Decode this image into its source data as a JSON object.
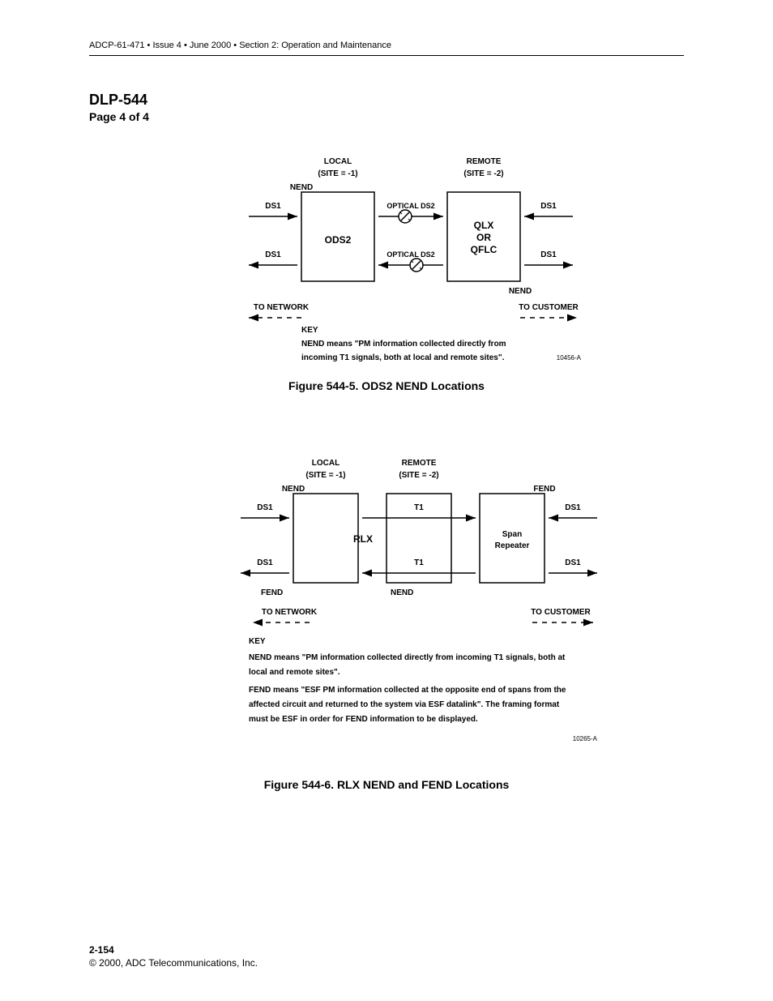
{
  "header": "ADCP-61-471 • Issue 4 • June 2000 • Section 2: Operation and Maintenance",
  "dlp": {
    "title": "DLP-544",
    "page": "Page 4 of 4"
  },
  "fig1": {
    "caption": "Figure 544-5. ODS2 NEND Locations",
    "code": "10456-A",
    "local_t": "LOCAL",
    "local_s": "(SITE = -1)",
    "remote_t": "REMOTE",
    "remote_s": "(SITE = -2)",
    "nend": "NEND",
    "ds1": "DS1",
    "opt_ds2": "OPTICAL DS2",
    "ods2": "ODS2",
    "qlx1": "QLX",
    "qlx2": "OR",
    "qlx3": "QFLC",
    "to_net": "TO NETWORK",
    "to_cust": "TO CUSTOMER",
    "key_h": "KEY",
    "key_t1": "NEND means \"PM information collected directly from",
    "key_t2": "incoming T1 signals, both at local and remote sites\"."
  },
  "fig2": {
    "caption": "Figure 544-6. RLX NEND and FEND Locations",
    "code": "10265-A",
    "local_t": "LOCAL",
    "local_s": "(SITE = -1)",
    "remote_t": "REMOTE",
    "remote_s": "(SITE = -2)",
    "nend": "NEND",
    "fend": "FEND",
    "ds1": "DS1",
    "t1": "T1",
    "rlx": "RLX",
    "span1": "Span",
    "span2": "Repeater",
    "to_net": "TO NETWORK",
    "to_cust": "TO CUSTOMER",
    "key_h": "KEY",
    "key_l1": "NEND means \"PM information collected directly from incoming T1 signals, both at",
    "key_l2": "local and remote sites\".",
    "key_l3": "FEND means \"ESF PM information collected at the opposite end of spans from the",
    "key_l4": "affected circuit and returned to the system via ESF datalink\". The framing format",
    "key_l5": "must be ESF in order for FEND information to be displayed."
  },
  "footer": {
    "page": "2-154",
    "copy": "© 2000, ADC Telecommunications, Inc."
  }
}
